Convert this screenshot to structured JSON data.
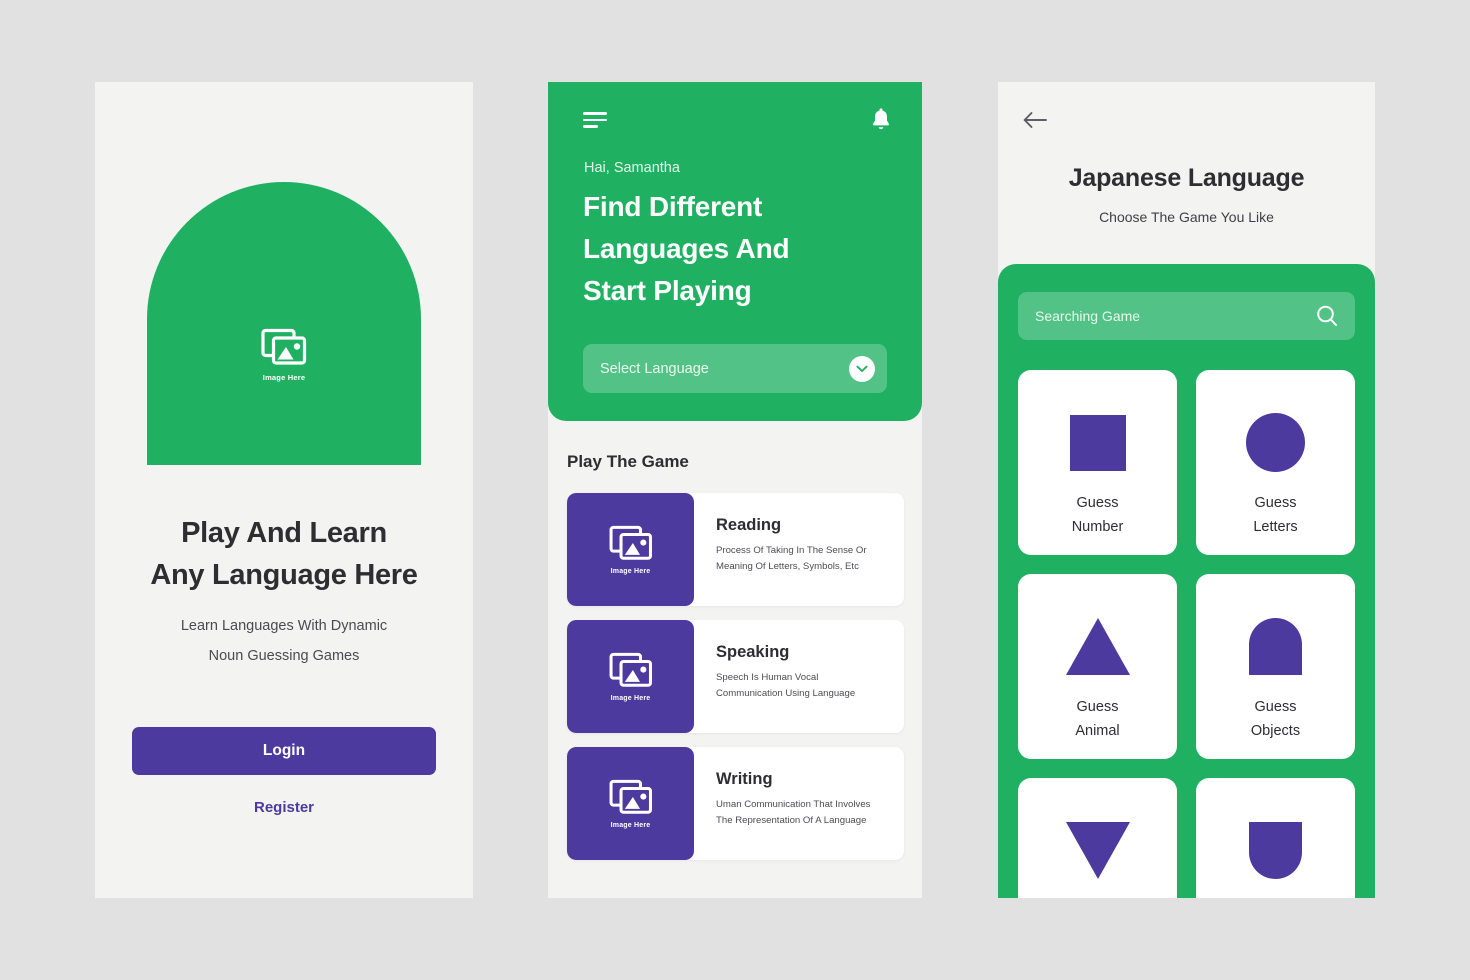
{
  "theme": {
    "page_background": "#e1e1e1",
    "panel_background": "#f3f3f1",
    "green": "#1fb062",
    "purple": "#4c3a9e",
    "text_dark": "#2d2d32",
    "white": "#ffffff"
  },
  "screen1": {
    "hero_image_caption": "Image Here",
    "title_line1": "Play And Learn",
    "title_line2": "Any Language Here",
    "subtitle_line1": "Learn Languages With Dynamic",
    "subtitle_line2": "Noun Guessing Games",
    "login_label": "Login",
    "register_label": "Register"
  },
  "screen2": {
    "menu_icon": "hamburger-icon",
    "notification_icon": "bell-icon",
    "greeting": "Hai, Samantha",
    "headline_line1": "Find Different",
    "headline_line2": "Languages And",
    "headline_line3": "Start Playing",
    "select_placeholder": "Select Language",
    "select_icon": "chevron-down-icon",
    "section_title": "Play The Game",
    "games": [
      {
        "title": "Reading",
        "desc_line1": "Process Of Taking In The Sense Or",
        "desc_line2": "Meaning Of Letters, Symbols, Etc",
        "thumb_caption": "Image Here"
      },
      {
        "title": "Speaking",
        "desc_line1": "Speech Is Human Vocal",
        "desc_line2": "Communication Using Language",
        "thumb_caption": "Image Here"
      },
      {
        "title": "Writing",
        "desc_line1": "Uman Communication That Involves",
        "desc_line2": "The Representation Of A Language",
        "thumb_caption": "Image Here"
      }
    ]
  },
  "screen3": {
    "back_icon": "arrow-left-icon",
    "title": "Japanese Language",
    "subtitle": "Choose The Game You Like",
    "search_placeholder": "Searching Game",
    "search_icon": "search-icon",
    "tiles": [
      {
        "shape": "square",
        "label_line1": "Guess",
        "label_line2": "Number"
      },
      {
        "shape": "circle",
        "label_line1": "Guess",
        "label_line2": "Letters"
      },
      {
        "shape": "triangle-up",
        "label_line1": "Guess",
        "label_line2": "Animal"
      },
      {
        "shape": "arch",
        "label_line1": "Guess",
        "label_line2": "Objects"
      },
      {
        "shape": "triangle-down",
        "label_line1": "",
        "label_line2": ""
      },
      {
        "shape": "u-shape",
        "label_line1": "",
        "label_line2": ""
      }
    ]
  }
}
